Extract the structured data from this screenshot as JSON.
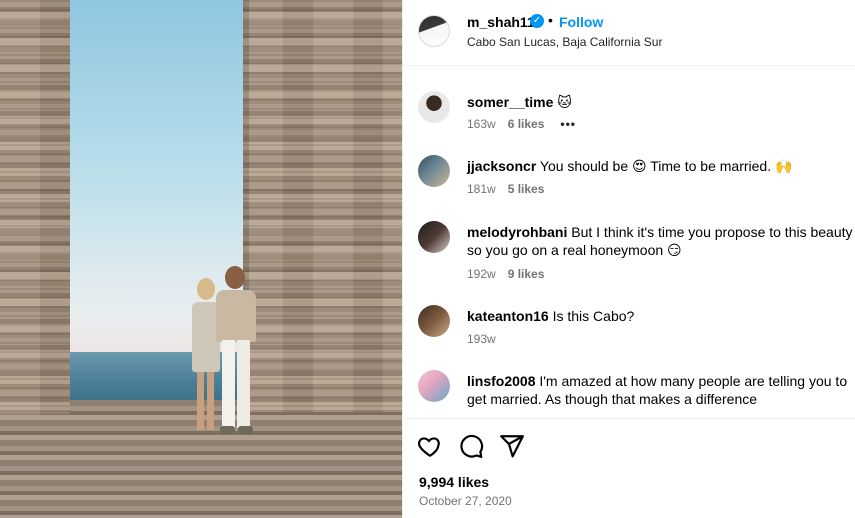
{
  "post": {
    "owner_username": "m_shah11",
    "follow_label": "Follow",
    "separator": "•",
    "location": "Cabo San Lucas, Baja California Sur",
    "likes": "9,994 likes",
    "date": "October 27, 2020"
  },
  "comments": [
    {
      "user": "somer__time",
      "text": " 🐱",
      "age": "163w",
      "likes": "6 likes",
      "more": "•••"
    },
    {
      "user": "jjacksoncr",
      "text": " You should be 😍 Time to be married. 🙌",
      "age": "181w",
      "likes": "5 likes"
    },
    {
      "user": "melodyrohbani",
      "text": " But I think it's time you propose to this beauty",
      "text2": "so you go on a real honeymoon 😏",
      "age": "192w",
      "likes": "9 likes"
    },
    {
      "user": "kateanton16",
      "text": " Is this Cabo?",
      "age": "193w"
    },
    {
      "user": "linsfo2008",
      "text": " I'm amazed at how many people are telling you to",
      "text2": "get married. As though that makes a difference"
    }
  ],
  "icons": {
    "verified": "verified-badge-icon",
    "like": "heart-icon",
    "comment": "comment-icon",
    "share": "share-icon",
    "more": "more-options-icon"
  },
  "colors": {
    "accent": "#0095f6",
    "muted": "#737373",
    "border": "#efefef"
  }
}
